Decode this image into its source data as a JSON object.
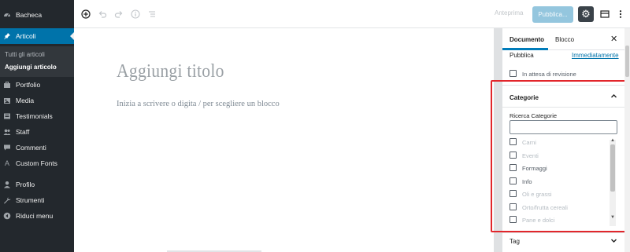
{
  "admin_menu": {
    "items": [
      {
        "label": "Bacheca",
        "icon": "dashboard-icon"
      },
      {
        "label": "Articoli",
        "icon": "pin-icon"
      },
      {
        "label": "Portfolio",
        "icon": "portfolio-icon"
      },
      {
        "label": "Media",
        "icon": "media-icon"
      },
      {
        "label": "Testimonials",
        "icon": "testimonials-icon"
      },
      {
        "label": "Staff",
        "icon": "staff-icon"
      },
      {
        "label": "Commenti",
        "icon": "comment-icon"
      },
      {
        "label": "Custom Fonts",
        "icon": "letter-a-icon"
      },
      {
        "label": "Profilo",
        "icon": "user-icon"
      },
      {
        "label": "Strumenti",
        "icon": "wrench-icon"
      },
      {
        "label": "Riduci menu",
        "icon": "collapse-icon"
      }
    ],
    "submenu": [
      "Tutti gli articoli",
      "Aggiungi articolo"
    ]
  },
  "toolbar": {
    "preview_label": "Anteprima",
    "publish_label": "Pubblica..."
  },
  "editor": {
    "title_placeholder": "Aggiungi titolo",
    "block_prompt": "Inizia a scrivere o digita / per scegliere un blocco"
  },
  "settings_panel": {
    "tabs": [
      "Documento",
      "Blocco"
    ],
    "publish_label": "Pubblica",
    "publish_value": "Immediatamente",
    "pending_review_label": "In attesa di revisione",
    "categories": {
      "title": "Categorie",
      "search_label": "Ricerca Categorie",
      "items": [
        "Carni",
        "Eventi",
        "Formaggi",
        "Info",
        "Oli e grassi",
        "Orto/frutta cereali",
        "Pane e dolci"
      ]
    },
    "tags_title": "Tag"
  },
  "colors": {
    "admin_bg": "#23282d",
    "accent": "#0073aa",
    "highlight_border": "#e2262b"
  }
}
